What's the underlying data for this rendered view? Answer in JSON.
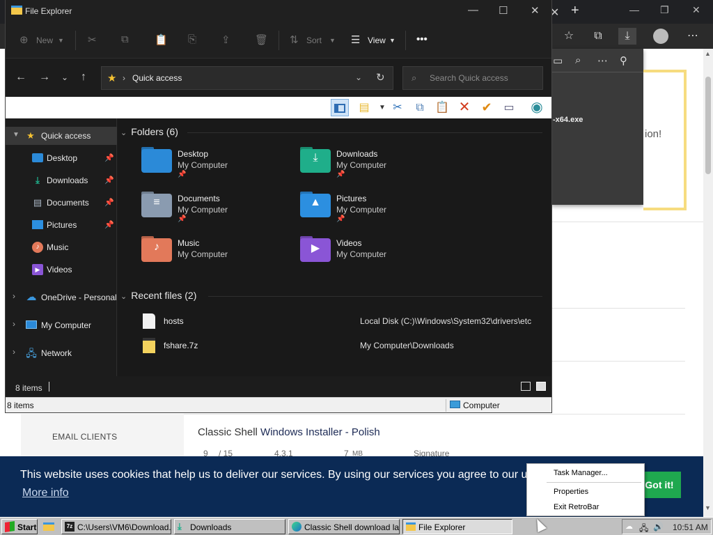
{
  "explorer": {
    "title": "File Explorer",
    "commands": {
      "new": "New",
      "sort": "Sort",
      "view": "View"
    },
    "address": "Quick access",
    "search_placeholder": "Search Quick access",
    "nav": [
      {
        "label": "Quick access",
        "icon": "star-icon"
      },
      {
        "label": "Desktop",
        "icon": "desktop-icon"
      },
      {
        "label": "Downloads",
        "icon": "download-icon"
      },
      {
        "label": "Documents",
        "icon": "document-icon"
      },
      {
        "label": "Pictures",
        "icon": "picture-icon"
      },
      {
        "label": "Music",
        "icon": "music-icon"
      },
      {
        "label": "Videos",
        "icon": "video-icon"
      },
      {
        "label": "OneDrive - Personal",
        "icon": "cloud-icon"
      },
      {
        "label": "My Computer",
        "icon": "computer-icon"
      },
      {
        "label": "Network",
        "icon": "network-icon"
      }
    ],
    "folders_header": "Folders (6)",
    "folders": [
      {
        "name": "Desktop",
        "location": "My Computer",
        "color": "#2b8ad8"
      },
      {
        "name": "Downloads",
        "location": "My Computer",
        "color": "#1fae8a"
      },
      {
        "name": "Documents",
        "location": "My Computer",
        "color": "#8a9bb0"
      },
      {
        "name": "Pictures",
        "location": "My Computer",
        "color": "#2c8fe0"
      },
      {
        "name": "Music",
        "location": "My Computer",
        "color": "#e2795a"
      },
      {
        "name": "Videos",
        "location": "My Computer",
        "color": "#8a55d6"
      }
    ],
    "recent_header": "Recent files (2)",
    "recent_files": [
      {
        "name": "hosts",
        "path": "Local Disk (C:)\\Windows\\System32\\drivers\\etc"
      },
      {
        "name": "fshare.7z",
        "path": "My Computer\\Downloads"
      }
    ],
    "status_items": "8 items",
    "status_bar_items": "8 items",
    "status_location": "Computer"
  },
  "browser": {
    "download_file": "-x64.exe",
    "notice_fragment": "ion!",
    "email_clients": "EMAIL CLIENTS",
    "installer_prefix": "Classic Shell ",
    "installer_title": "Windows Installer - Polish",
    "installer_meta": {
      "score": "9",
      "of": "/ 15",
      "version": "4.3.1",
      "size": "7",
      "size_unit": "MB",
      "signature": "Signature"
    },
    "cookie_text": "This website uses cookies that help us to deliver our services. By using our services you agree to our u",
    "cookie_more": "More info",
    "cookie_ok": "Got it!"
  },
  "context_menu": {
    "items": [
      "Task Manager...",
      "Properties",
      "Exit RetroBar"
    ]
  },
  "taskbar": {
    "start": "Start",
    "buttons": [
      "C:\\Users\\VM6\\Download...",
      "Downloads",
      "Classic Shell download lat...",
      "File Explorer"
    ],
    "clock": "10:51 AM"
  }
}
